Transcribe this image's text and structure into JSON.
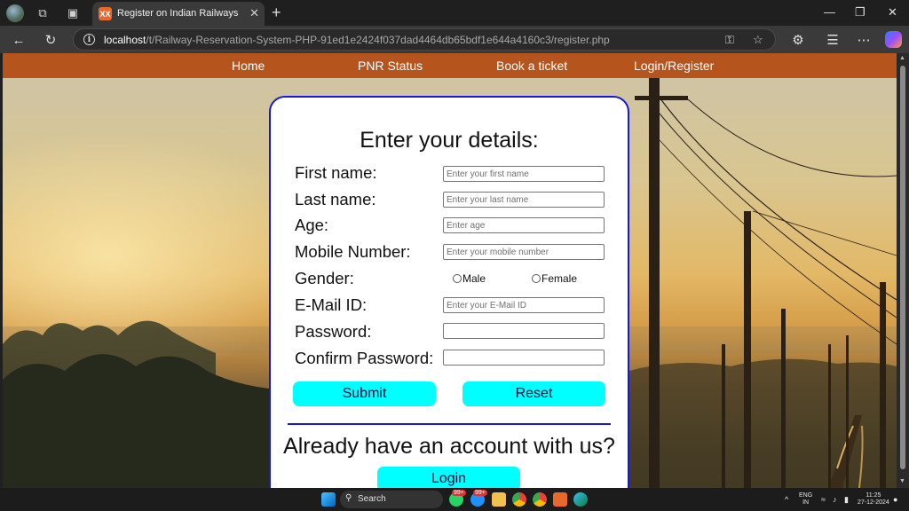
{
  "browser": {
    "tab_title": "Register on Indian Railways",
    "tab_favicon_text": "XX",
    "url_host": "localhost",
    "url_path": "/t/Railway-Reservation-System-PHP-91ed1e2424f037dad4464db65bdf1e644a4160c3/register.php"
  },
  "site_nav": {
    "items": [
      "Home",
      "PNR Status",
      "Book a ticket",
      "Login/Register"
    ]
  },
  "form": {
    "title": "Enter your details:",
    "fields": [
      {
        "label": "First name:",
        "placeholder": "Enter your first name"
      },
      {
        "label": "Last name:",
        "placeholder": "Enter your last name"
      },
      {
        "label": "Age:",
        "placeholder": "Enter age"
      },
      {
        "label": "Mobile Number:",
        "placeholder": "Enter your mobile number"
      },
      {
        "label": "Gender:"
      },
      {
        "label": "E-Mail ID:",
        "placeholder": "Enter your E-Mail ID"
      },
      {
        "label": "Password:",
        "placeholder": ""
      },
      {
        "label": "Confirm Password:",
        "placeholder": ""
      }
    ],
    "gender_options": [
      "Male",
      "Female"
    ],
    "submit_label": "Submit",
    "reset_label": "Reset",
    "account_question": "Already have an account with us?",
    "login_label": "Login"
  },
  "taskbar": {
    "search_label": "Search",
    "badge_1": "99+",
    "badge_2": "99+",
    "lang_top": "ENG",
    "lang_bottom": "IN",
    "time": "11:25",
    "date": "27-12-2024"
  },
  "icons": [
    "profile-avatar",
    "workspaces-icon",
    "tab-actions-icon",
    "xampp-favicon",
    "close-icon",
    "plus-icon",
    "minimize-icon",
    "maximize-icon",
    "back-icon",
    "refresh-icon",
    "info-icon",
    "key-icon",
    "star-icon",
    "extensions-icon",
    "favorites-icon",
    "more-icon",
    "copilot-icon",
    "windows-start-icon",
    "search-icon"
  ],
  "colors": {
    "site_nav": "#b5541c",
    "card_border": "#1717d6",
    "button_bg": "#00ffff"
  }
}
